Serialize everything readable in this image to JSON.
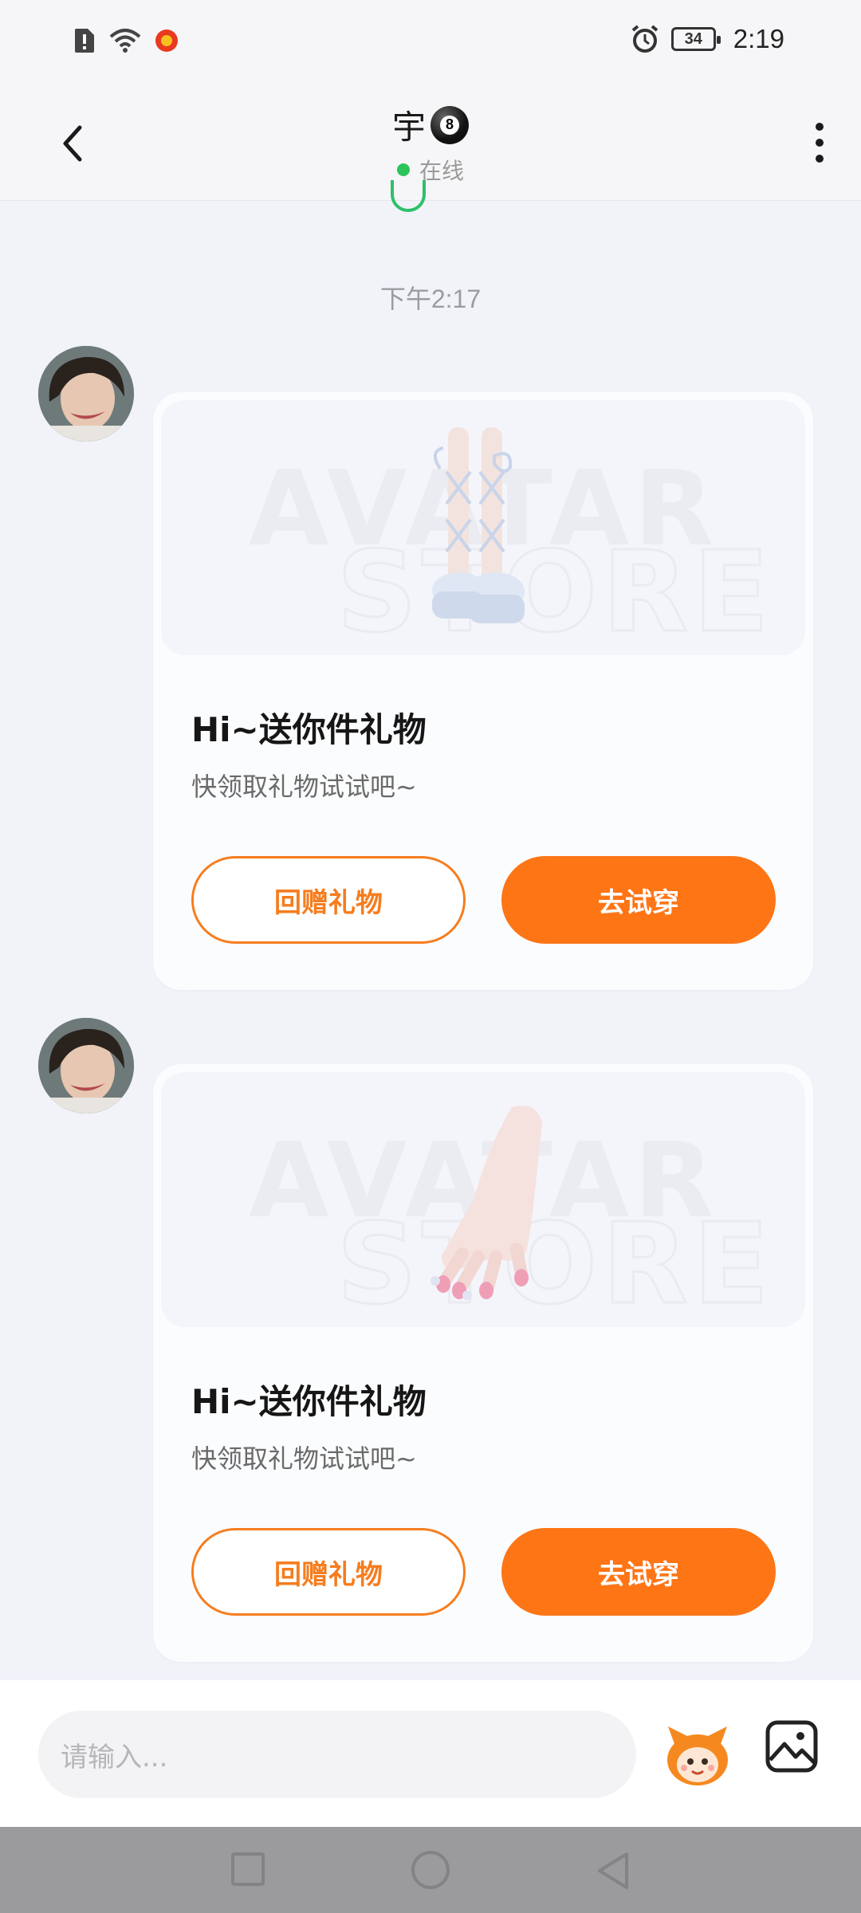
{
  "status_bar": {
    "time": "2:19",
    "battery": "34",
    "icons": [
      "sim-alert-icon",
      "wifi-icon",
      "app-notification-icon",
      "alarm-icon",
      "battery-icon"
    ]
  },
  "header": {
    "title": "宇",
    "badge": "8",
    "status": "在线",
    "icons": [
      "back-arrow-icon",
      "more-vertical-icon"
    ]
  },
  "chat": {
    "timestamp": "下午2:17",
    "messages": [
      {
        "type": "gift-card",
        "image_watermark": "AVATAR STORE",
        "gift": "ribbon-platform-shoes",
        "title": "Hi~送你件礼物",
        "subtitle": "快领取礼物试试吧~",
        "secondary_button": "回赠礼物",
        "primary_button": "去试穿"
      },
      {
        "type": "gift-card",
        "image_watermark": "AVATAR STORE",
        "gift": "pink-nail-art-hand",
        "title": "Hi~送你件礼物",
        "subtitle": "快领取礼物试试吧~",
        "secondary_button": "回赠礼物",
        "primary_button": "去试穿"
      }
    ]
  },
  "input": {
    "placeholder": "请输入..."
  },
  "colors": {
    "accent": "#fe7516",
    "background": "#f1f3f9",
    "online": "#2cc45a"
  }
}
